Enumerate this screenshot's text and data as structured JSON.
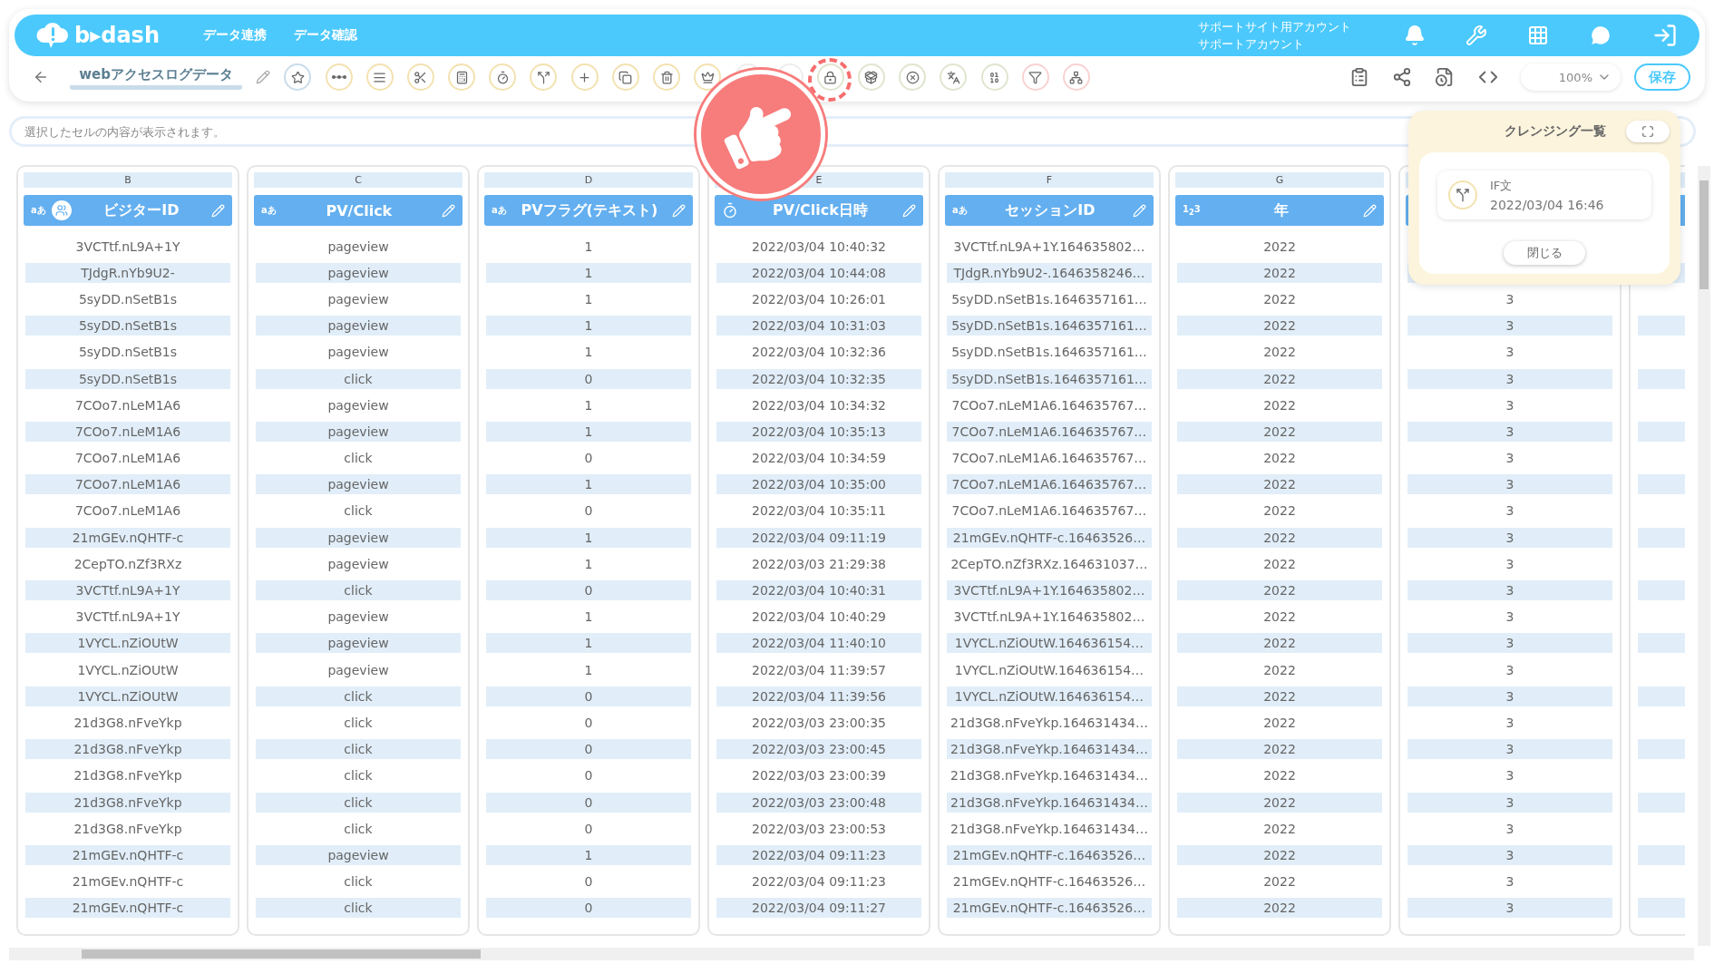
{
  "header": {
    "logo": "b▸dash",
    "nav": [
      {
        "label": "データ連携"
      },
      {
        "label": "データ確認"
      }
    ],
    "account": {
      "site": "サポートサイト用アカウント",
      "user": "サポートアカウント"
    }
  },
  "toolbar": {
    "title": "webアクセスログデータ",
    "zoom": "100%",
    "save": "保存"
  },
  "formula_bar": {
    "placeholder": "選択したセルの内容が表示されます。"
  },
  "columns": [
    {
      "letter": "B",
      "kind": "text",
      "badge": "aあ",
      "name": "ビジターID",
      "group": true
    },
    {
      "letter": "C",
      "kind": "text",
      "badge": "aあ",
      "name": "PV/Click"
    },
    {
      "letter": "D",
      "kind": "text",
      "badge": "aあ",
      "name": "PVフラグ(テキスト)"
    },
    {
      "letter": "E",
      "kind": "datetime",
      "name": "PV/Click日時"
    },
    {
      "letter": "F",
      "kind": "text",
      "badge": "aあ",
      "name": "セッションID"
    },
    {
      "letter": "G",
      "kind": "number",
      "badge": "1$_{2}$3",
      "name": "年"
    },
    {
      "kind": "hidden"
    },
    {
      "kind": "hidden"
    }
  ],
  "rows": [
    [
      "3VCTtf.nL9A+1Y",
      "pageview",
      "1",
      "2022/03/04 10:40:32",
      "3VCTtf.nL9A+1Y.164635802…",
      "2022"
    ],
    [
      "TJdgR.nYb9U2-",
      "pageview",
      "1",
      "2022/03/04 10:44:08",
      "TJdgR.nYb9U2-.1646358246…",
      "2022"
    ],
    [
      "5syDD.nSetB1s",
      "pageview",
      "1",
      "2022/03/04 10:26:01",
      "5syDD.nSetB1s.1646357161…",
      "2022",
      "3"
    ],
    [
      "5syDD.nSetB1s",
      "pageview",
      "1",
      "2022/03/04 10:31:03",
      "5syDD.nSetB1s.1646357161…",
      "2022",
      "3"
    ],
    [
      "5syDD.nSetB1s",
      "pageview",
      "1",
      "2022/03/04 10:32:36",
      "5syDD.nSetB1s.1646357161…",
      "2022",
      "3"
    ],
    [
      "5syDD.nSetB1s",
      "click",
      "0",
      "2022/03/04 10:32:35",
      "5syDD.nSetB1s.1646357161…",
      "2022",
      "3"
    ],
    [
      "7COo7.nLeM1A6",
      "pageview",
      "1",
      "2022/03/04 10:34:32",
      "7COo7.nLeM1A6.164635767…",
      "2022",
      "3"
    ],
    [
      "7COo7.nLeM1A6",
      "pageview",
      "1",
      "2022/03/04 10:35:13",
      "7COo7.nLeM1A6.164635767…",
      "2022",
      "3"
    ],
    [
      "7COo7.nLeM1A6",
      "click",
      "0",
      "2022/03/04 10:34:59",
      "7COo7.nLeM1A6.164635767…",
      "2022",
      "3"
    ],
    [
      "7COo7.nLeM1A6",
      "pageview",
      "1",
      "2022/03/04 10:35:00",
      "7COo7.nLeM1A6.164635767…",
      "2022",
      "3"
    ],
    [
      "7COo7.nLeM1A6",
      "click",
      "0",
      "2022/03/04 10:35:11",
      "7COo7.nLeM1A6.164635767…",
      "2022",
      "3"
    ],
    [
      "21mGEv.nQHTF-c",
      "pageview",
      "1",
      "2022/03/04 09:11:19",
      "21mGEv.nQHTF-c.16463526…",
      "2022",
      "3"
    ],
    [
      "2CepTO.nZf3RXz",
      "pageview",
      "1",
      "2022/03/03 21:29:38",
      "2CepTO.nZf3RXz.164631037…",
      "2022",
      "3"
    ],
    [
      "3VCTtf.nL9A+1Y",
      "click",
      "0",
      "2022/03/04 10:40:31",
      "3VCTtf.nL9A+1Y.164635802…",
      "2022",
      "3"
    ],
    [
      "3VCTtf.nL9A+1Y",
      "pageview",
      "1",
      "2022/03/04 10:40:29",
      "3VCTtf.nL9A+1Y.164635802…",
      "2022",
      "3"
    ],
    [
      "1VYCL.nZiOUtW",
      "pageview",
      "1",
      "2022/03/04 11:40:10",
      "1VYCL.nZiOUtW.164636154…",
      "2022",
      "3"
    ],
    [
      "1VYCL.nZiOUtW",
      "pageview",
      "1",
      "2022/03/04 11:39:57",
      "1VYCL.nZiOUtW.164636154…",
      "2022",
      "3"
    ],
    [
      "1VYCL.nZiOUtW",
      "click",
      "0",
      "2022/03/04 11:39:56",
      "1VYCL.nZiOUtW.164636154…",
      "2022",
      "3"
    ],
    [
      "21d3G8.nFveYkp",
      "click",
      "0",
      "2022/03/03 23:00:35",
      "21d3G8.nFveYkp.164631434…",
      "2022",
      "3"
    ],
    [
      "21d3G8.nFveYkp",
      "click",
      "0",
      "2022/03/03 23:00:45",
      "21d3G8.nFveYkp.164631434…",
      "2022",
      "3"
    ],
    [
      "21d3G8.nFveYkp",
      "click",
      "0",
      "2022/03/03 23:00:39",
      "21d3G8.nFveYkp.164631434…",
      "2022",
      "3"
    ],
    [
      "21d3G8.nFveYkp",
      "click",
      "0",
      "2022/03/03 23:00:48",
      "21d3G8.nFveYkp.164631434…",
      "2022",
      "3"
    ],
    [
      "21d3G8.nFveYkp",
      "click",
      "0",
      "2022/03/03 23:00:53",
      "21d3G8.nFveYkp.164631434…",
      "2022",
      "3"
    ],
    [
      "21mGEv.nQHTF-c",
      "pageview",
      "1",
      "2022/03/04 09:11:23",
      "21mGEv.nQHTF-c.16463526…",
      "2022",
      "3"
    ],
    [
      "21mGEv.nQHTF-c",
      "click",
      "0",
      "2022/03/04 09:11:23",
      "21mGEv.nQHTF-c.16463526…",
      "2022",
      "3"
    ],
    [
      "21mGEv.nQHTF-c",
      "click",
      "0",
      "2022/03/04 09:11:27",
      "21mGEv.nQHTF-c.16463526…",
      "2022",
      "3"
    ]
  ],
  "cleansing_panel": {
    "title": "クレンジング一覧",
    "items": [
      {
        "name": "IF文",
        "time": "2022/03/04 16:46"
      }
    ],
    "close": "閉じる"
  }
}
